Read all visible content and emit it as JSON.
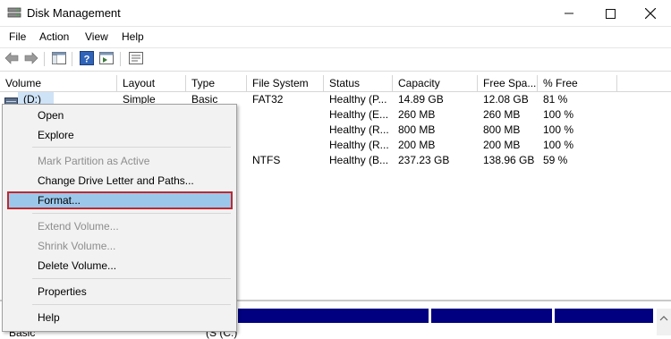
{
  "window": {
    "title": "Disk Management"
  },
  "menubar": [
    "File",
    "Action",
    "View",
    "Help"
  ],
  "table": {
    "columns": [
      "Volume",
      "Layout",
      "Type",
      "File System",
      "Status",
      "Capacity",
      "Free Spa...",
      "% Free"
    ],
    "rows": [
      {
        "volume": "(D:)",
        "layout": "Simple",
        "type": "Basic",
        "fs": "FAT32",
        "status": "Healthy (P...",
        "capacity": "14.89 GB",
        "free": "12.08 GB",
        "pct": "81 %"
      },
      {
        "volume": "",
        "layout": "",
        "type": "",
        "fs": "",
        "status": "Healthy (E...",
        "capacity": "260 MB",
        "free": "260 MB",
        "pct": "100 %"
      },
      {
        "volume": "",
        "layout": "",
        "type": "",
        "fs": "",
        "status": "Healthy (R...",
        "capacity": "800 MB",
        "free": "800 MB",
        "pct": "100 %"
      },
      {
        "volume": "",
        "layout": "",
        "type": "",
        "fs": "",
        "status": "Healthy (R...",
        "capacity": "200 MB",
        "free": "200 MB",
        "pct": "100 %"
      },
      {
        "volume": "",
        "layout": "",
        "type": "",
        "fs": "NTFS",
        "status": "Healthy (B...",
        "capacity": "237.23 GB",
        "free": "138.96 GB",
        "pct": "59 %"
      }
    ]
  },
  "lower_panel": {
    "disk_type_label": "Basic",
    "partial_label": "(S (C:)"
  },
  "context_menu": {
    "items": [
      {
        "label": "Open",
        "enabled": true
      },
      {
        "label": "Explore",
        "enabled": true
      },
      {
        "label": "Mark Partition as Active",
        "enabled": false
      },
      {
        "label": "Change Drive Letter and Paths...",
        "enabled": true
      },
      {
        "label": "Format...",
        "enabled": true,
        "highlighted": true
      },
      {
        "label": "Extend Volume...",
        "enabled": false
      },
      {
        "label": "Shrink Volume...",
        "enabled": false
      },
      {
        "label": "Delete Volume...",
        "enabled": true
      },
      {
        "label": "Properties",
        "enabled": true
      },
      {
        "label": "Help",
        "enabled": true
      }
    ]
  },
  "colors": {
    "highlight": "#9bc7ea",
    "highlight_border": "#c0282f",
    "disk_bar": "#000080"
  },
  "icons": [
    "app-disk-icon",
    "minimize-icon",
    "maximize-icon",
    "close-icon",
    "back-arrow-icon",
    "forward-arrow-icon",
    "console-tree-icon",
    "help-icon",
    "show-hide-icon",
    "properties-icon",
    "volume-icon"
  ]
}
